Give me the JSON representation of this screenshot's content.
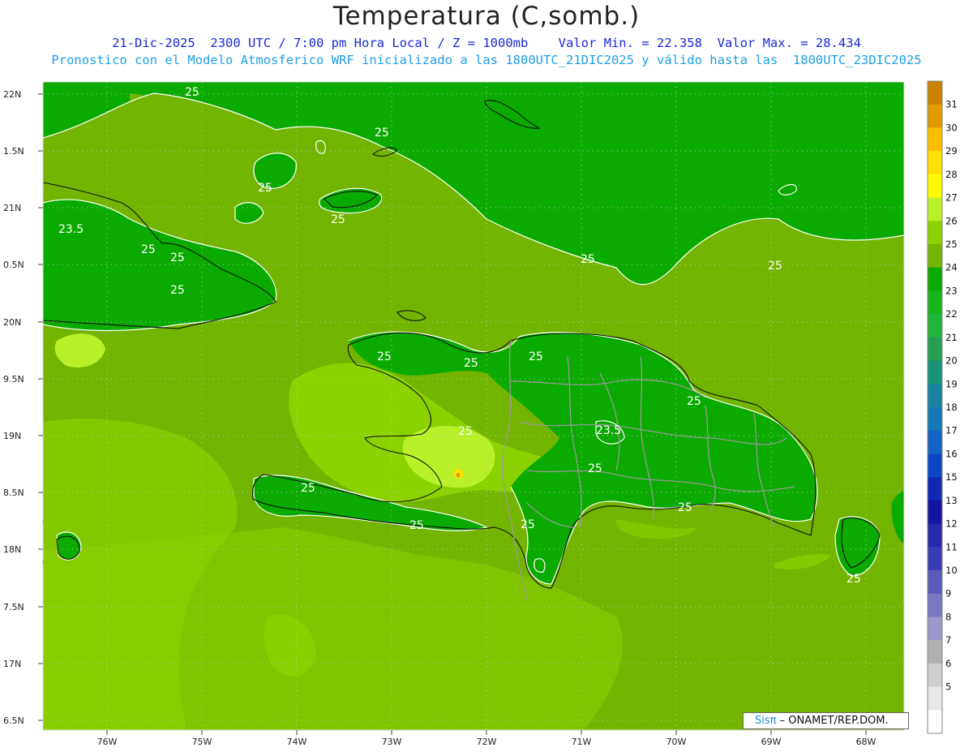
{
  "header": {
    "title": "Temperatura (C,somb.)",
    "line1": "21-Dic-2025  2300 UTC / 7:00 pm Hora Local / Z = 1000mb    Valor Min. = 22.358  Valor Max. = 28.434",
    "line2": "Pronostico con el Modelo Atmosferico WRF inicializado a las 1800UTC_21DIC2025 y válido hasta las  1800UTC_23DIC2025"
  },
  "axes": {
    "lat_labels": [
      "22N",
      "1.5N",
      "21N",
      "0.5N",
      "20N",
      "9.5N",
      "19N",
      "8.5N",
      "18N",
      "7.5N",
      "17N",
      "6.5N"
    ],
    "lon_labels": [
      "76W",
      "75W",
      "74W",
      "73W",
      "72W",
      "71W",
      "70W",
      "69W",
      "68W"
    ]
  },
  "contour_labels": [
    {
      "text": "25"
    },
    {
      "text": "25"
    },
    {
      "text": "25"
    },
    {
      "text": "25"
    },
    {
      "text": "23.5"
    },
    {
      "text": "25"
    },
    {
      "text": "25"
    },
    {
      "text": "25"
    },
    {
      "text": "25"
    },
    {
      "text": "25"
    },
    {
      "text": "25"
    },
    {
      "text": "25"
    },
    {
      "text": "25"
    },
    {
      "text": "25"
    },
    {
      "text": "23.5"
    },
    {
      "text": "25"
    },
    {
      "text": "25"
    },
    {
      "text": "25"
    },
    {
      "text": "25"
    },
    {
      "text": "25"
    },
    {
      "text": "25"
    },
    {
      "text": "25"
    }
  ],
  "colorbar": {
    "labels": [
      "31",
      "30",
      "29",
      "28",
      "27",
      "26",
      "25",
      "24",
      "23",
      "22",
      "21",
      "20",
      "19",
      "18",
      "17",
      "16",
      "15",
      "13",
      "12",
      "11",
      "10",
      "9",
      "8",
      "7",
      "6",
      "5"
    ],
    "colors": [
      "#c88200",
      "#e19a00",
      "#ffbe00",
      "#ffe100",
      "#fffa00",
      "#b9f02a",
      "#8cd200",
      "#73b400",
      "#0aaa00",
      "#18b41e",
      "#23b43c",
      "#26a050",
      "#1a9478",
      "#1682a0",
      "#1478b4",
      "#1464c8",
      "#0f46c8",
      "#0f28b4",
      "#1414a0",
      "#2828aa",
      "#3c3cb4",
      "#5a5ab9",
      "#7a78c2",
      "#9a98cc",
      "#b0b0b0",
      "#cfcfcf",
      "#e8e8e8",
      "#ffffff"
    ]
  },
  "credit": {
    "brand": "Sisπ",
    "text": " – ONAMET/REP.DOM."
  }
}
